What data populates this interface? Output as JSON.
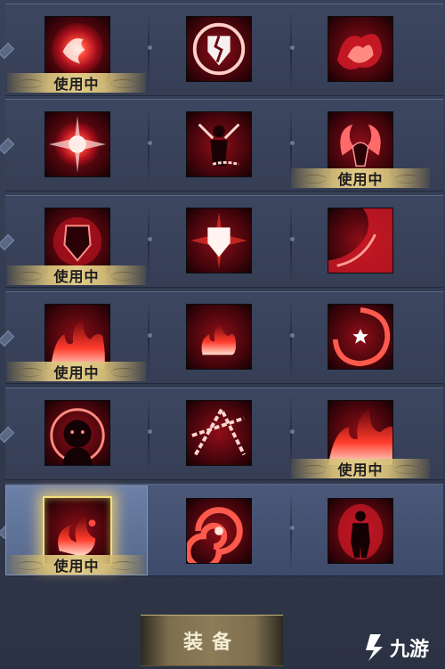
{
  "active_label": "使用中",
  "equip_button_label": "装备",
  "watermark_text": "九游",
  "colors": {
    "badge_gold": "#d6be78",
    "selected_glow": "#f4dd7a",
    "skill_red": "#b3121e"
  },
  "rows": [
    {
      "slots": [
        {
          "icon": "sun-flame-orb-icon",
          "active": true
        },
        {
          "icon": "cracked-shield-icon",
          "active": false
        },
        {
          "icon": "crimson-fire-swirl-icon",
          "active": false
        }
      ]
    },
    {
      "slots": [
        {
          "icon": "radiant-burst-icon",
          "active": false
        },
        {
          "icon": "chained-figure-icon",
          "active": false
        },
        {
          "icon": "demon-horns-icon",
          "active": true
        }
      ]
    },
    {
      "slots": [
        {
          "icon": "flame-armor-icon",
          "active": true
        },
        {
          "icon": "glowing-shield-icon",
          "active": false
        },
        {
          "icon": "blood-wave-icon",
          "active": false
        }
      ]
    },
    {
      "slots": [
        {
          "icon": "rising-flames-icon",
          "active": true
        },
        {
          "icon": "fire-burst-icon",
          "active": false
        },
        {
          "icon": "spiral-star-icon",
          "active": false
        }
      ]
    },
    {
      "slots": [
        {
          "icon": "screaming-head-icon",
          "active": false
        },
        {
          "icon": "chain-triangle-icon",
          "active": false
        },
        {
          "icon": "flame-burst-corner-icon",
          "active": true
        }
      ]
    },
    {
      "slots": [
        {
          "icon": "phoenix-flame-icon",
          "active": true,
          "selected": true
        },
        {
          "icon": "red-vortex-icon",
          "active": false
        },
        {
          "icon": "flaming-warrior-icon",
          "active": false
        }
      ]
    }
  ]
}
